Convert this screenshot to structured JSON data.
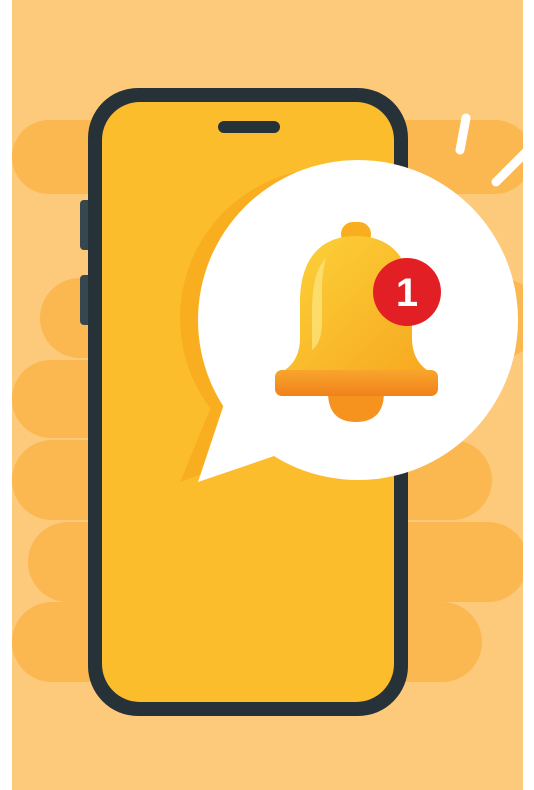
{
  "illustration": {
    "subject": "smartphone-notification",
    "colors": {
      "page_background": "#ffffff",
      "panel_background": "#fdc97a",
      "stripe_color": "#fbb750",
      "phone_frame": "#263238",
      "phone_screen": "#fcbd2c",
      "speech_bubble": "#ffffff",
      "bubble_shadow": "#f9ae1f",
      "bell_body": "#fbbf20",
      "bell_base": "#f6921e",
      "badge": "#e31f26",
      "badge_text": "#ffffff"
    },
    "icons": [
      "phone-icon",
      "speech-bubble-icon",
      "bell-icon",
      "notification-badge"
    ]
  },
  "badge": {
    "count": "1"
  }
}
